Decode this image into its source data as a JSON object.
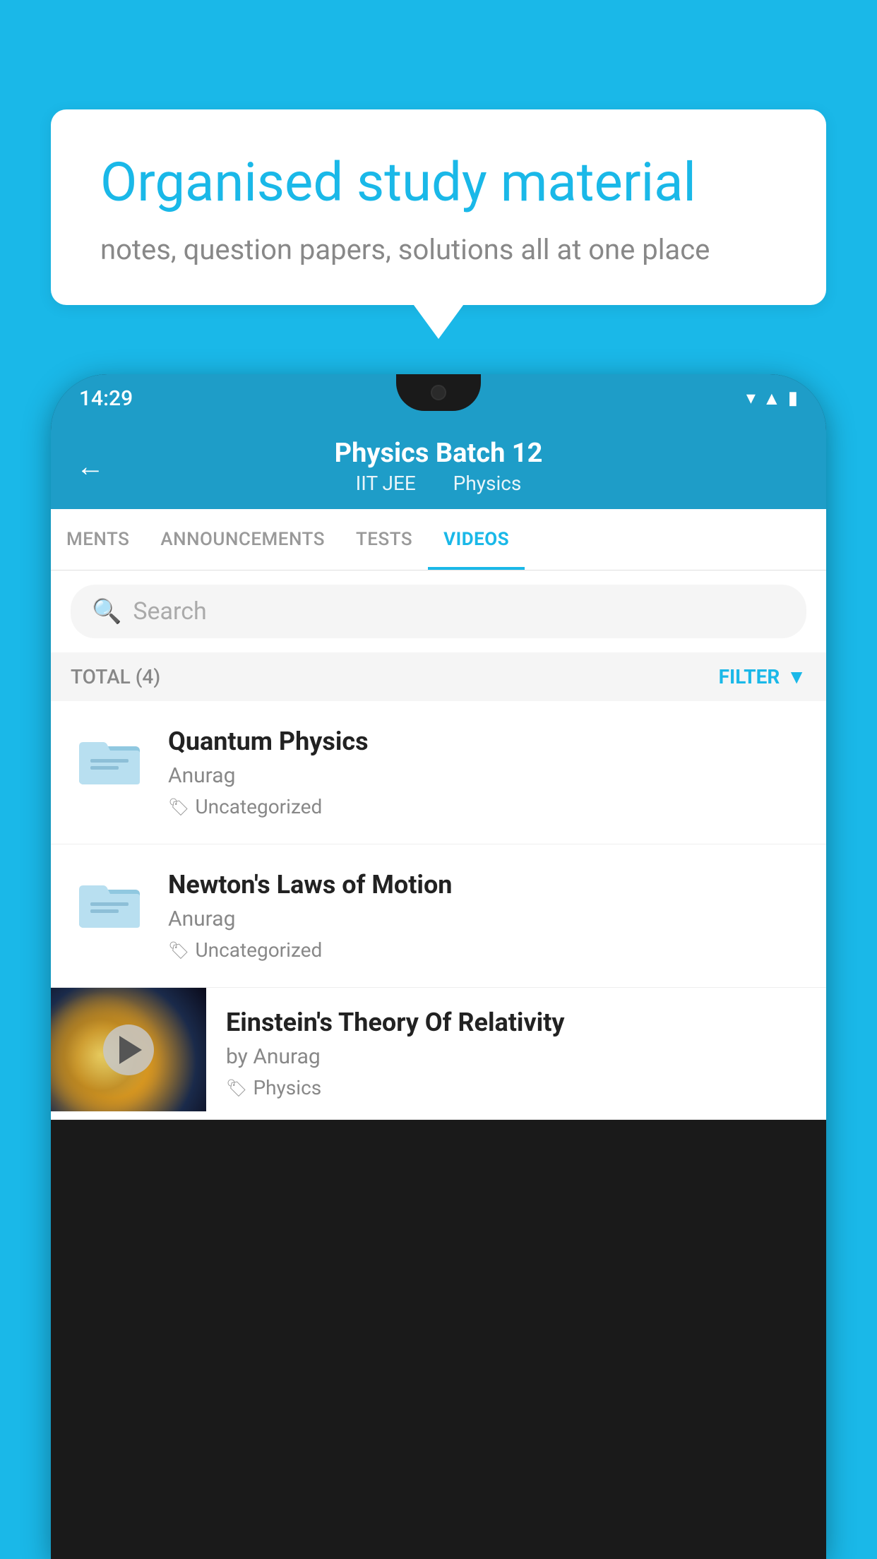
{
  "background_color": "#1ab8e8",
  "speech_bubble": {
    "heading": "Organised study material",
    "subtext": "notes, question papers, solutions all at one place"
  },
  "status_bar": {
    "time": "14:29"
  },
  "app_header": {
    "back_label": "←",
    "title": "Physics Batch 12",
    "subtitle_part1": "IIT JEE",
    "subtitle_part2": "Physics"
  },
  "tabs": [
    {
      "label": "MENTS",
      "active": false
    },
    {
      "label": "ANNOUNCEMENTS",
      "active": false
    },
    {
      "label": "TESTS",
      "active": false
    },
    {
      "label": "VIDEOS",
      "active": true
    }
  ],
  "search": {
    "placeholder": "Search"
  },
  "filter_bar": {
    "total_label": "TOTAL (4)",
    "filter_label": "FILTER"
  },
  "videos": [
    {
      "id": 1,
      "title": "Quantum Physics",
      "author": "Anurag",
      "tag": "Uncategorized",
      "has_thumb": false
    },
    {
      "id": 2,
      "title": "Newton's Laws of Motion",
      "author": "Anurag",
      "tag": "Uncategorized",
      "has_thumb": false
    },
    {
      "id": 3,
      "title": "Einstein's Theory Of Relativity",
      "author": "by Anurag",
      "tag": "Physics",
      "has_thumb": true
    }
  ]
}
